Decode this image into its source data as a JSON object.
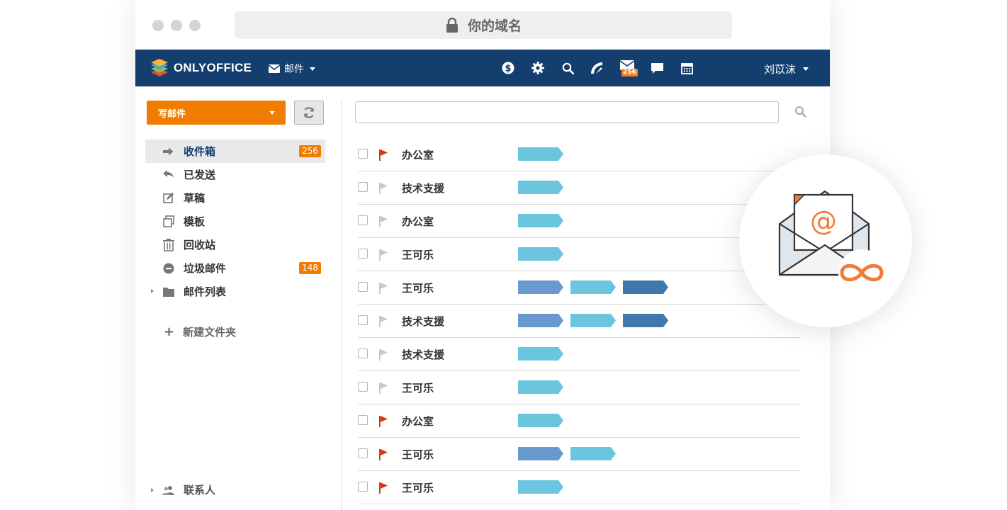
{
  "browser": {
    "address": "你的域名"
  },
  "nav": {
    "logo_text": "ONLYOFFICE",
    "module_label": "邮件",
    "mail_badge": "256",
    "user_name": "刘苡沫",
    "icons": [
      "dollar-icon",
      "gear-icon",
      "search-icon",
      "feed-icon",
      "mail-icon",
      "chat-icon",
      "calendar-icon"
    ]
  },
  "sidebar": {
    "compose_label": "写邮件",
    "folders": [
      {
        "label": "收件箱",
        "count": "256",
        "icon": "inbox-arrow-icon"
      },
      {
        "label": "已发送",
        "count": "",
        "icon": "reply-icon"
      },
      {
        "label": "草稿",
        "count": "",
        "icon": "draft-edit-icon"
      },
      {
        "label": "模板",
        "count": "",
        "icon": "template-icon"
      },
      {
        "label": "回收站",
        "count": "",
        "icon": "trash-icon"
      },
      {
        "label": "垃圾邮件",
        "count": "148",
        "icon": "spam-minus-icon"
      },
      {
        "label": "邮件列表",
        "count": "",
        "icon": "folder-icon"
      }
    ],
    "new_folder_label": "新建文件夹",
    "contacts_label": "联系人"
  },
  "search": {
    "placeholder": ""
  },
  "messages": [
    {
      "from": "办公室",
      "flagged": true,
      "tags": [
        "light"
      ]
    },
    {
      "from": "技术支援",
      "flagged": false,
      "tags": [
        "light"
      ]
    },
    {
      "from": "办公室",
      "flagged": false,
      "tags": [
        "light"
      ]
    },
    {
      "from": "王可乐",
      "flagged": false,
      "tags": [
        "light"
      ]
    },
    {
      "from": "王可乐",
      "flagged": false,
      "tags": [
        "medium",
        "light",
        "dark"
      ]
    },
    {
      "from": "技术支援",
      "flagged": false,
      "tags": [
        "medium",
        "light",
        "dark"
      ]
    },
    {
      "from": "技术支援",
      "flagged": false,
      "tags": [
        "light"
      ]
    },
    {
      "from": "王可乐",
      "flagged": false,
      "tags": [
        "light"
      ]
    },
    {
      "from": "办公室",
      "flagged": true,
      "tags": [
        "light"
      ]
    },
    {
      "from": "王可乐",
      "flagged": true,
      "tags": [
        "medium",
        "light"
      ]
    },
    {
      "from": "王可乐",
      "flagged": true,
      "tags": [
        "light"
      ]
    }
  ],
  "colors": {
    "nav_bg": "#143e6e",
    "accent_orange": "#f07c00",
    "tag_light": "#6cc5de",
    "tag_medium": "#6a99d0",
    "tag_dark": "#4078ad",
    "flag_red": "#d4380d",
    "flag_grey": "#c8c8c8"
  }
}
